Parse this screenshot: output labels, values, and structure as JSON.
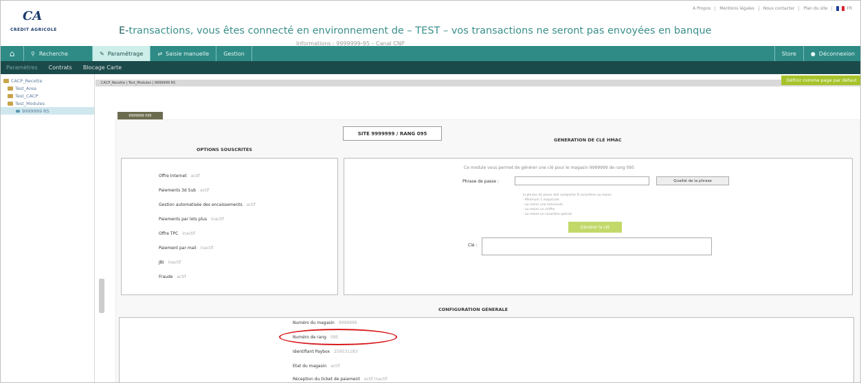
{
  "brand": {
    "logo_mark": "CA",
    "logo_text": "CREDIT AGRICOLE"
  },
  "banner": {
    "lead": "E-",
    "text": "transactions, vous êtes connecté en environnement de – TEST – vos transactions ne seront pas envoyées en banque"
  },
  "toplinks": [
    "A Propos",
    "Mentions légales",
    "Nous contacter",
    "Plan du site",
    "FR"
  ],
  "nav": {
    "search": "Recherche",
    "parametrage": "Paramétrage",
    "saisie": "Saisie manuelle",
    "gestion": "Gestion",
    "right1": "Store",
    "user": "Déconnexion"
  },
  "subnav": [
    "Paramètres",
    "Contrats",
    "Blocage Carte"
  ],
  "tree": [
    {
      "label": "CACP_Recette",
      "level": 0
    },
    {
      "label": "Test_Area",
      "level": 1
    },
    {
      "label": "Test_CACP",
      "level": 1
    },
    {
      "label": "Test_Modules",
      "level": 1
    },
    {
      "label": "9999999 RS",
      "level": 2
    }
  ],
  "crumb": "CACP_Recette | Test_Modules | 9999999 RS",
  "green_button": "Définir comme page par défaut",
  "info_title": "Informations : 9999999-95 – Canal CNP",
  "tab_label": "9999999 095",
  "site_box": "SITE 9999999 / RANG 095",
  "options": {
    "title": "OPTIONS SOUSCRITES",
    "items": [
      {
        "label": "Offre Internet",
        "value": "actif"
      },
      {
        "label": "Paiements 3d Sub",
        "value": "actif"
      },
      {
        "label": "Gestion automatisée des encaissements",
        "value": "actif"
      },
      {
        "label": "Paiements par lots plus",
        "value": "inactif"
      },
      {
        "label": "Offre TPC",
        "value": "inactif"
      },
      {
        "label": "Paiement par mail",
        "value": "inactif"
      },
      {
        "label": "JBI",
        "value": "inactif"
      },
      {
        "label": "Fraude",
        "value": "actif"
      }
    ]
  },
  "hmac": {
    "title": "GENERATION DE CLE HMAC",
    "note": "Ce module vous permet de générer une clé pour le magasin 9999999 de rang 095",
    "pass_label": "Phrase de passe :",
    "pass_button": "Qualité de la phrase",
    "hints": [
      "la phrase de passe doit comporter 8 caractères au moins",
      "- Minimum 1 majuscule",
      "- au moins une minuscule",
      "- au moins un chiffre",
      "- au moins un caractère spécial"
    ],
    "generate_button": "Générer la clé",
    "cle_label": "Clé :"
  },
  "config": {
    "title": "CONFIGURATION GENERALE",
    "items": [
      {
        "label": "Numéro du magasin",
        "value": "9999999"
      },
      {
        "label": "Numéro de rang",
        "value": "095"
      },
      {
        "label": "Identifiant Paybox",
        "value": "259531183"
      },
      {
        "label": "Etat du magasin",
        "value": "actif"
      },
      {
        "label": "Réception du ticket de paiement",
        "value": "actif   inactif"
      }
    ]
  },
  "colors": {
    "nav": "#2e8b86",
    "subnav": "#1b4a4a",
    "accent_green": "#a6c32b",
    "highlight_circle": "#d7191c"
  }
}
